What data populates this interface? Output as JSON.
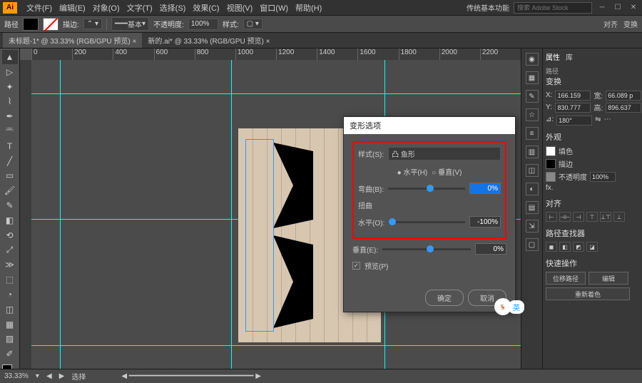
{
  "app": {
    "logo": "Ai",
    "workspace": "传统基本功能",
    "search_placeholder": "搜索 Adobe Stock"
  },
  "menu": {
    "file": "文件(F)",
    "edit": "编辑(E)",
    "object": "对象(O)",
    "type": "文字(T)",
    "select": "选择(S)",
    "effect": "效果(C)",
    "view": "视图(V)",
    "window": "窗口(W)",
    "help": "帮助(H)"
  },
  "optbar": {
    "pathlabel": "路径",
    "stroke": "描边:",
    "basic": "基本",
    "opacity": "不透明度:",
    "opacity_val": "100%",
    "style": "样式:",
    "align": "对齐",
    "transform": "变换"
  },
  "tabs": {
    "t1": "未标题-1* @ 33.33% (RGB/GPU 预览)",
    "t2": "新的.ai* @ 33.33% (RGB/GPU 预览)"
  },
  "ruler": {
    "r0": "0",
    "r1": "200",
    "r2": "400",
    "r3": "600",
    "r4": "800",
    "r5": "1000",
    "r6": "1200",
    "r7": "1400",
    "r8": "1600",
    "r9": "1800",
    "r10": "2000",
    "r11": "2200"
  },
  "dialog": {
    "title": "变形选项",
    "styleLabel": "样式(S):",
    "styleVal": "凸 鱼形",
    "horiz": "● 水平(H)",
    "vert": "○ 垂直(V)",
    "bendLabel": "弯曲(B):",
    "bendVal": "0%",
    "distort": "扭曲",
    "hLabel": "水平(O):",
    "hVal": "-100%",
    "vLabel": "垂直(E):",
    "vVal": "0%",
    "preview": "预览(P)",
    "ok": "确定",
    "cancel": "取消"
  },
  "prop": {
    "tab1": "属性",
    "tab2": "库",
    "kind": "路径",
    "transform": "变换",
    "x": "X:",
    "xval": "166.159",
    "w": "宽:",
    "wval": "66.089 p",
    "y": "Y:",
    "yval": "830.777",
    "h": "高:",
    "hval": "896.637",
    "angle": "⊿:",
    "angleval": "180°",
    "appearance": "外观",
    "fill": "填色",
    "stroke": "描边",
    "op": "不透明度",
    "opval": "100%",
    "fx": "fx.",
    "align": "对齐",
    "pathfinder": "路径查找器",
    "quick": "快速操作",
    "offset": "位移路径",
    "edit": "编辑",
    "recolor": "重新着色"
  },
  "status": {
    "zoom": "33.33%",
    "sel": "选择"
  },
  "badge": {
    "text": "英"
  }
}
